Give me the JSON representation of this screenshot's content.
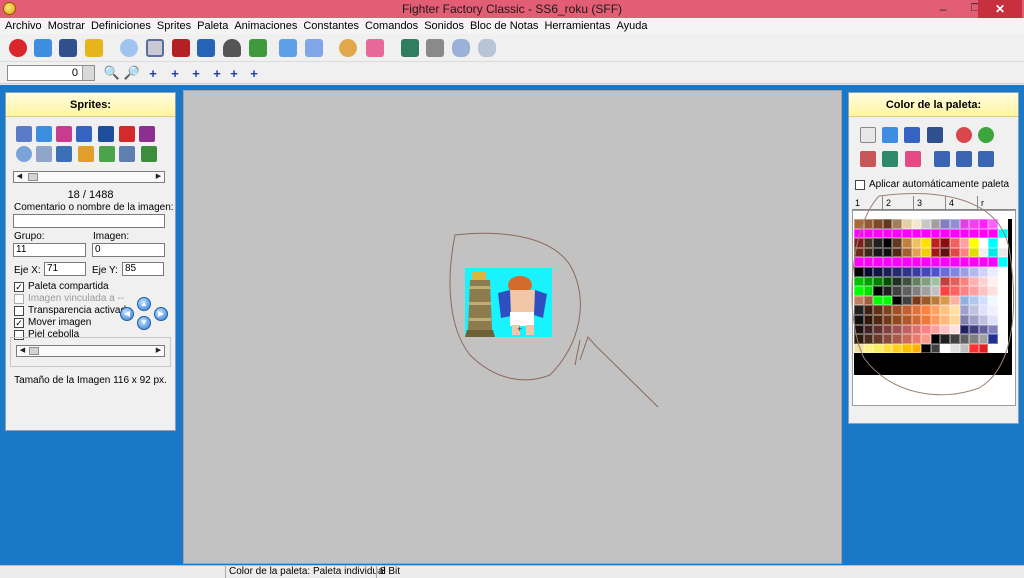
{
  "window": {
    "title": "Fighter Factory Classic - SS6_roku (SFF)",
    "minimize": "–",
    "maximize": "❐",
    "close": "✕"
  },
  "menu": [
    "Archivo",
    "Mostrar",
    "Definiciones",
    "Sprites",
    "Paleta",
    "Animaciones",
    "Constantes",
    "Comandos",
    "Sonidos",
    "Bloc de Notas",
    "Herramientas",
    "Ayuda"
  ],
  "toolbar": {
    "zoom_value": "0",
    "colors": {
      "red": "#d8262b",
      "blue": "#2b78d6",
      "gray": "#7a7a7a",
      "yellow": "#e8b41b",
      "green": "#4fa84f"
    }
  },
  "sprites_panel": {
    "title": "Sprites:",
    "counter": "18 / 1488",
    "comment_label": "Comentario o nombre de la imagen:",
    "comment_value": "",
    "group_label": "Grupo:",
    "group_value": "11",
    "image_label": "Imagen:",
    "image_value": "0",
    "axis_x_label": "Eje X:",
    "axis_x_value": "71",
    "axis_y_label": "Eje Y:",
    "axis_y_value": "85",
    "checkboxes": [
      {
        "label": "Paleta compartida",
        "checked": "✓",
        "disabled": false
      },
      {
        "label": "Imagen vinculada a --",
        "checked": "",
        "disabled": true
      },
      {
        "label": "Transparencia activada",
        "checked": "",
        "disabled": false
      },
      {
        "label": "Mover imagen",
        "checked": "✓",
        "disabled": false
      },
      {
        "label": "Piel cebolla",
        "checked": "",
        "disabled": false
      }
    ],
    "size_text": "Tamaño de la Imagen 116 x 92 px."
  },
  "palette_panel": {
    "title": "Color de la paleta:",
    "auto_apply_label": "Aplicar automáticamente paleta",
    "tabs": [
      "1",
      "2",
      "3",
      "4",
      "r"
    ]
  },
  "statusbar": {
    "palette_status": "Color de la paleta: Paleta individual",
    "bit_depth": "8 Bit"
  }
}
